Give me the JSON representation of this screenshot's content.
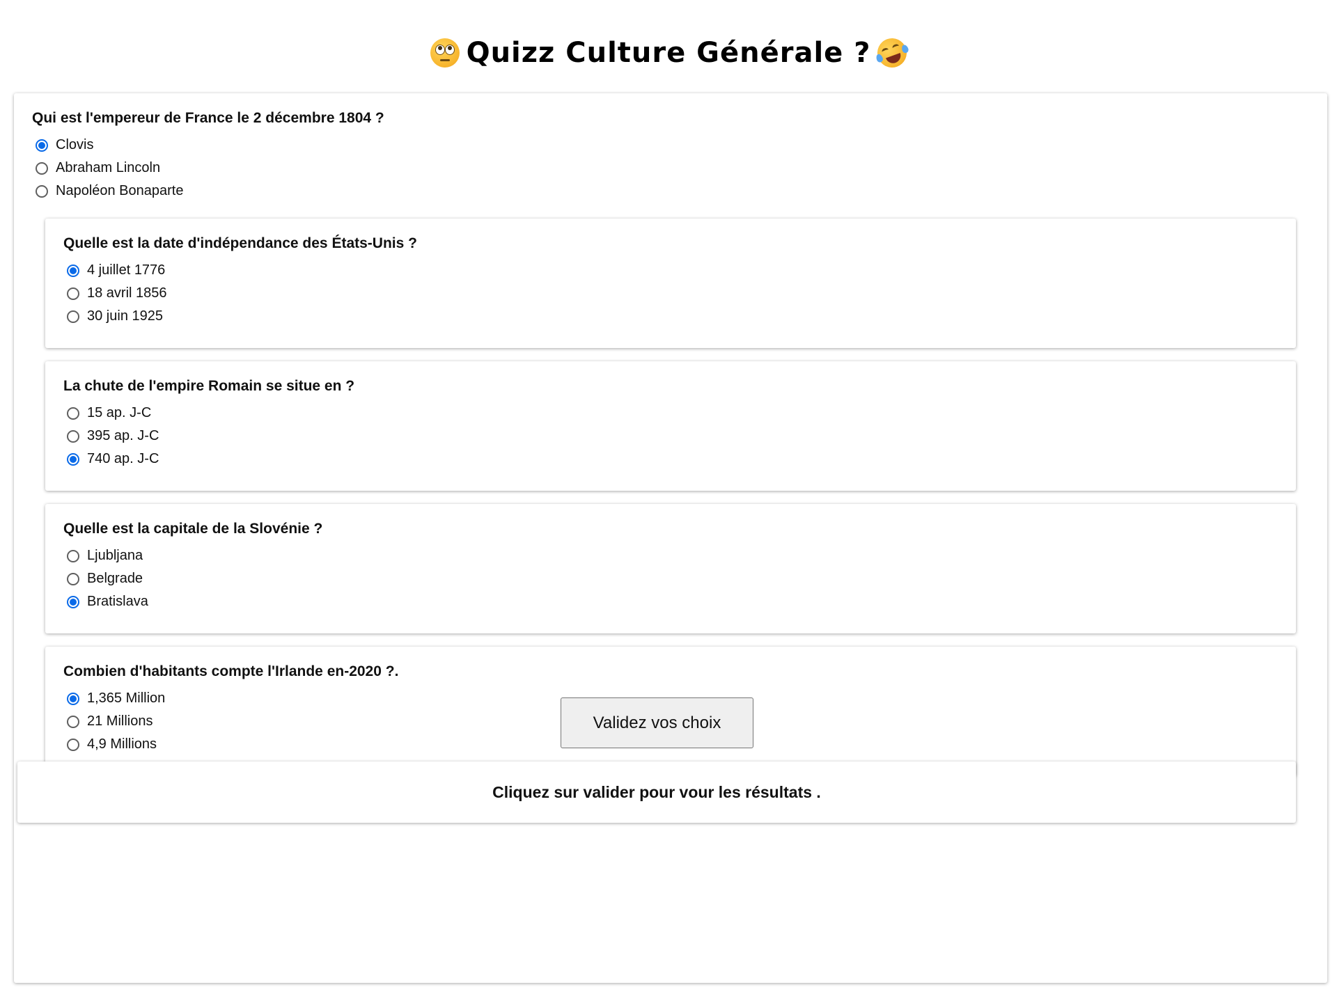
{
  "header": {
    "title": "Quizz Culture Générale ?",
    "left_emoji": "face-with-rolling-eyes-icon",
    "right_emoji": "rolling-on-the-floor-laughing-icon"
  },
  "questions": [
    {
      "title": "Qui est l'empereur de France le 2 décembre 1804 ?",
      "options": [
        {
          "label": "Clovis",
          "checked": true
        },
        {
          "label": "Abraham Lincoln",
          "checked": false
        },
        {
          "label": "Napoléon Bonaparte",
          "checked": false
        }
      ]
    },
    {
      "title": "Quelle est la date d'indépendance des États-Unis ?",
      "options": [
        {
          "label": "4 juillet 1776",
          "checked": true
        },
        {
          "label": "18 avril 1856",
          "checked": false
        },
        {
          "label": "30 juin 1925",
          "checked": false
        }
      ]
    },
    {
      "title": "La chute de l'empire Romain se situe en ?",
      "options": [
        {
          "label": "15 ap. J-C",
          "checked": false
        },
        {
          "label": "395 ap. J-C",
          "checked": false
        },
        {
          "label": "740 ap. J-C",
          "checked": true
        }
      ]
    },
    {
      "title": "Quelle est la capitale de la Slovénie ?",
      "options": [
        {
          "label": "Ljubljana",
          "checked": false
        },
        {
          "label": "Belgrade",
          "checked": false
        },
        {
          "label": "Bratislava",
          "checked": true
        }
      ]
    },
    {
      "title": "Combien d'habitants compte l'Irlande en-2020 ?.",
      "options": [
        {
          "label": "1,365 Million",
          "checked": true
        },
        {
          "label": "21 Millions",
          "checked": false
        },
        {
          "label": "4,9 Millions",
          "checked": false
        }
      ]
    }
  ],
  "validate_label": "Validez vos choix",
  "result_text": "Cliquez sur valider pour vour les résultats .",
  "colors": {
    "radio_checked": "#0a6ae8",
    "button_bg": "#efefef"
  }
}
